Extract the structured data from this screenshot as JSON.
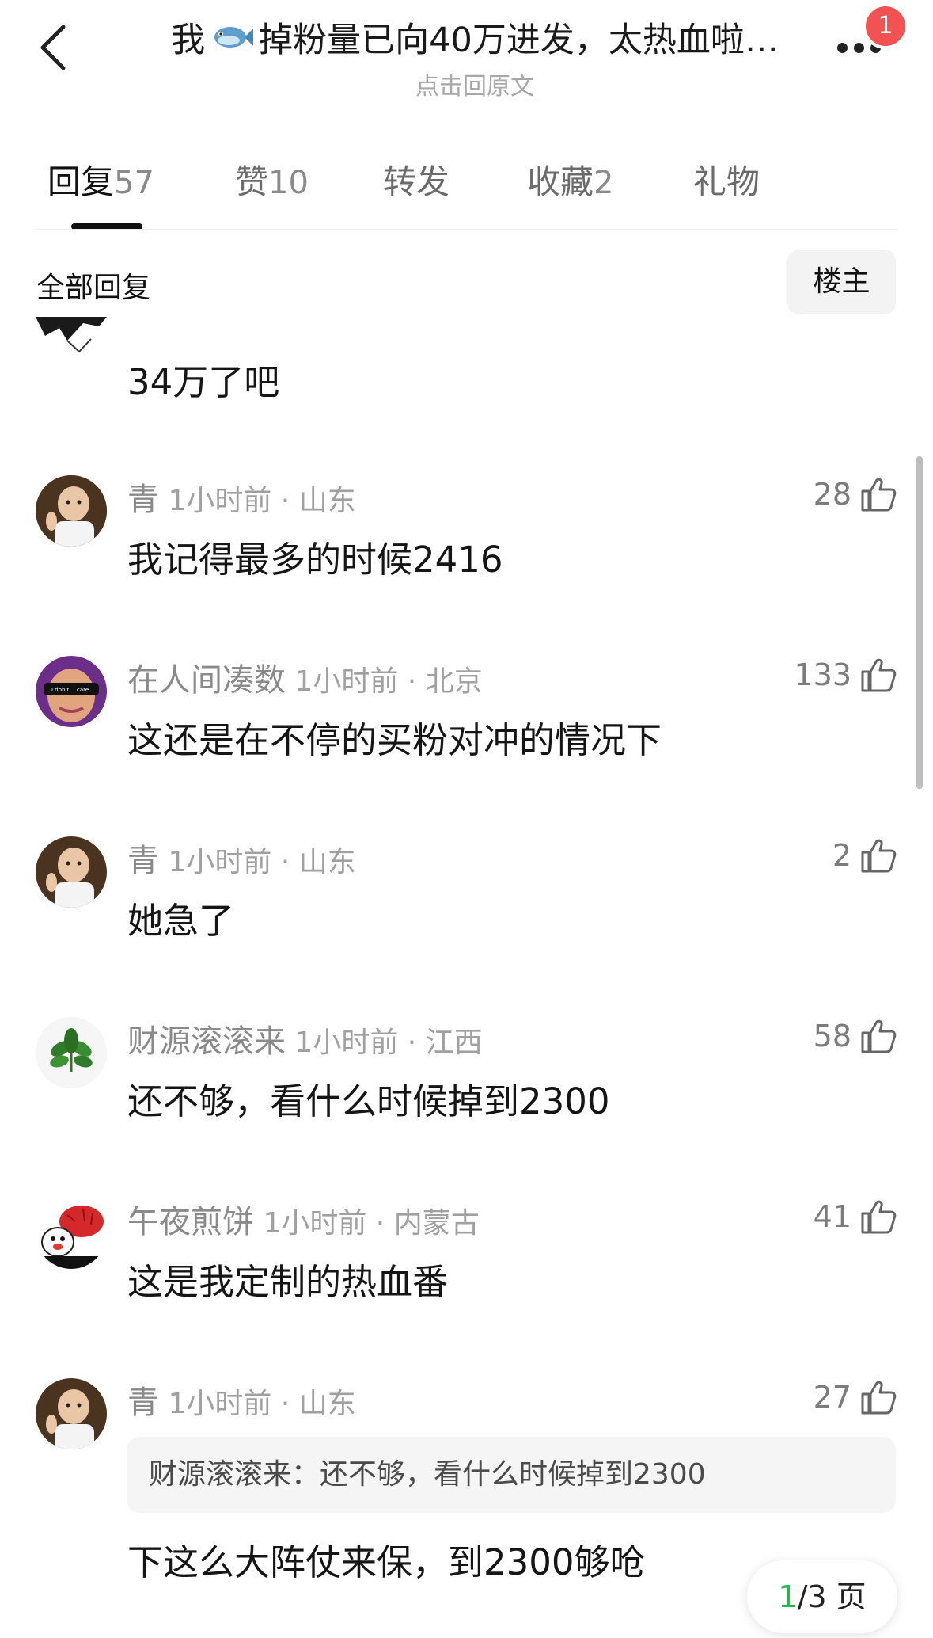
{
  "header": {
    "title_before": "我",
    "title_icon": "fish-icon",
    "title_after": "掉粉量已向40万进发，太热血啦…",
    "subtitle": "点击回原文",
    "badge_count": "1"
  },
  "tabs": [
    {
      "label": "回复",
      "count": "57"
    },
    {
      "label": "赞",
      "count": "10"
    },
    {
      "label": "转发",
      "count": ""
    },
    {
      "label": "收藏",
      "count": "2"
    },
    {
      "label": "礼物",
      "count": ""
    }
  ],
  "section": {
    "title": "全部回复",
    "op_filter_label": "楼主"
  },
  "comments": [
    {
      "body": "34万了吧"
    },
    {
      "name": "青",
      "time": "1小时前",
      "location": "山东",
      "likes": "28",
      "body": "我记得最多的时候2416"
    },
    {
      "name": "在人间凑数",
      "time": "1小时前",
      "location": "北京",
      "likes": "133",
      "body": "这还是在不停的买粉对冲的情况下"
    },
    {
      "name": "青",
      "time": "1小时前",
      "location": "山东",
      "likes": "2",
      "body": "她急了"
    },
    {
      "name": "财源滚滚来",
      "time": "1小时前",
      "location": "江西",
      "likes": "58",
      "body": "还不够，看什么时候掉到2300"
    },
    {
      "name": "午夜煎饼",
      "time": "1小时前",
      "location": "内蒙古",
      "likes": "41",
      "body": "这是我定制的热血番"
    },
    {
      "name": "青",
      "time": "1小时前",
      "location": "山东",
      "likes": "27",
      "quote": "财源滚滚来：还不够，看什么时候掉到2300",
      "body": "下这么大阵仗来保，到2300够呛"
    }
  ],
  "avatar_texts": {
    "sunglasses_left": "I don't",
    "sunglasses_right": "care"
  },
  "pager": {
    "current": "1",
    "rest": "/3 页"
  },
  "colors": {
    "accent_green": "#28b04a",
    "badge_red": "#f25352"
  }
}
